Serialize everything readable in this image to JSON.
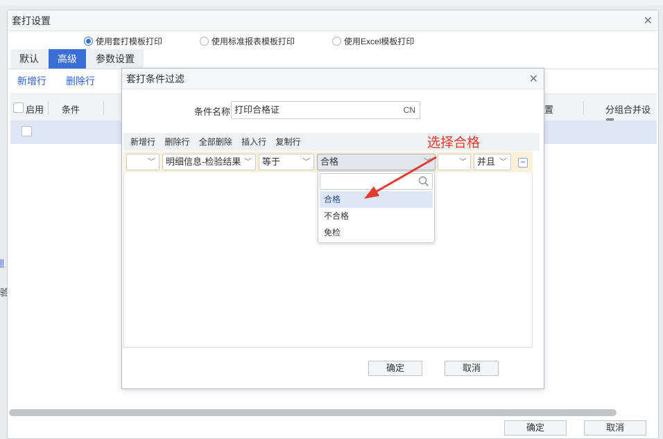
{
  "outer": {
    "title": "套打设置",
    "radios": [
      {
        "label": "使用套打模板打印",
        "checked": true
      },
      {
        "label": "使用标准报表模板打印",
        "checked": false
      },
      {
        "label": "使用Excel模板打印",
        "checked": false
      }
    ],
    "tabs": [
      {
        "label": "默认",
        "active": false
      },
      {
        "label": "高级",
        "active": true
      },
      {
        "label": "参数设置",
        "active": false
      }
    ],
    "toolbar": {
      "add_row": "新增行",
      "delete_row": "删除行"
    },
    "grid": {
      "headers": [
        "启用",
        "条件"
      ],
      "right_headers": [
        "置",
        "分组合并设置"
      ]
    },
    "confirm_label": "确定",
    "cancel_label": "取消"
  },
  "background": {
    "left_link": "ll",
    "left_text": "验"
  },
  "inner": {
    "title": "套打条件过滤",
    "condition_name_label": "条件名称",
    "condition_name_value": "打印合格证",
    "condition_name_lang": "CN",
    "toolbar": [
      "新增行",
      "删除行",
      "全部删除",
      "插入行",
      "复制行"
    ],
    "row": {
      "bracket_open": "",
      "field": "明细信息-检验结果",
      "operator": "等于",
      "value": "合格",
      "bracket_close": "",
      "logic": "并且",
      "remove": "−"
    },
    "dropdown": {
      "search_placeholder": "",
      "options": [
        "合格",
        "不合格",
        "免检"
      ],
      "highlighted_index": 0
    },
    "annotation": "选择合格",
    "confirm_label": "确定",
    "cancel_label": "取消"
  },
  "colors": {
    "accent": "#3a6fd8",
    "link": "#2b5fd9",
    "annotation": "#e53b2f",
    "row_highlight": "#fdf1dc"
  },
  "icons": {
    "close": "close-icon",
    "chevron": "chevron-down-icon",
    "search": "search-icon",
    "arrow": "annotation-arrow"
  }
}
